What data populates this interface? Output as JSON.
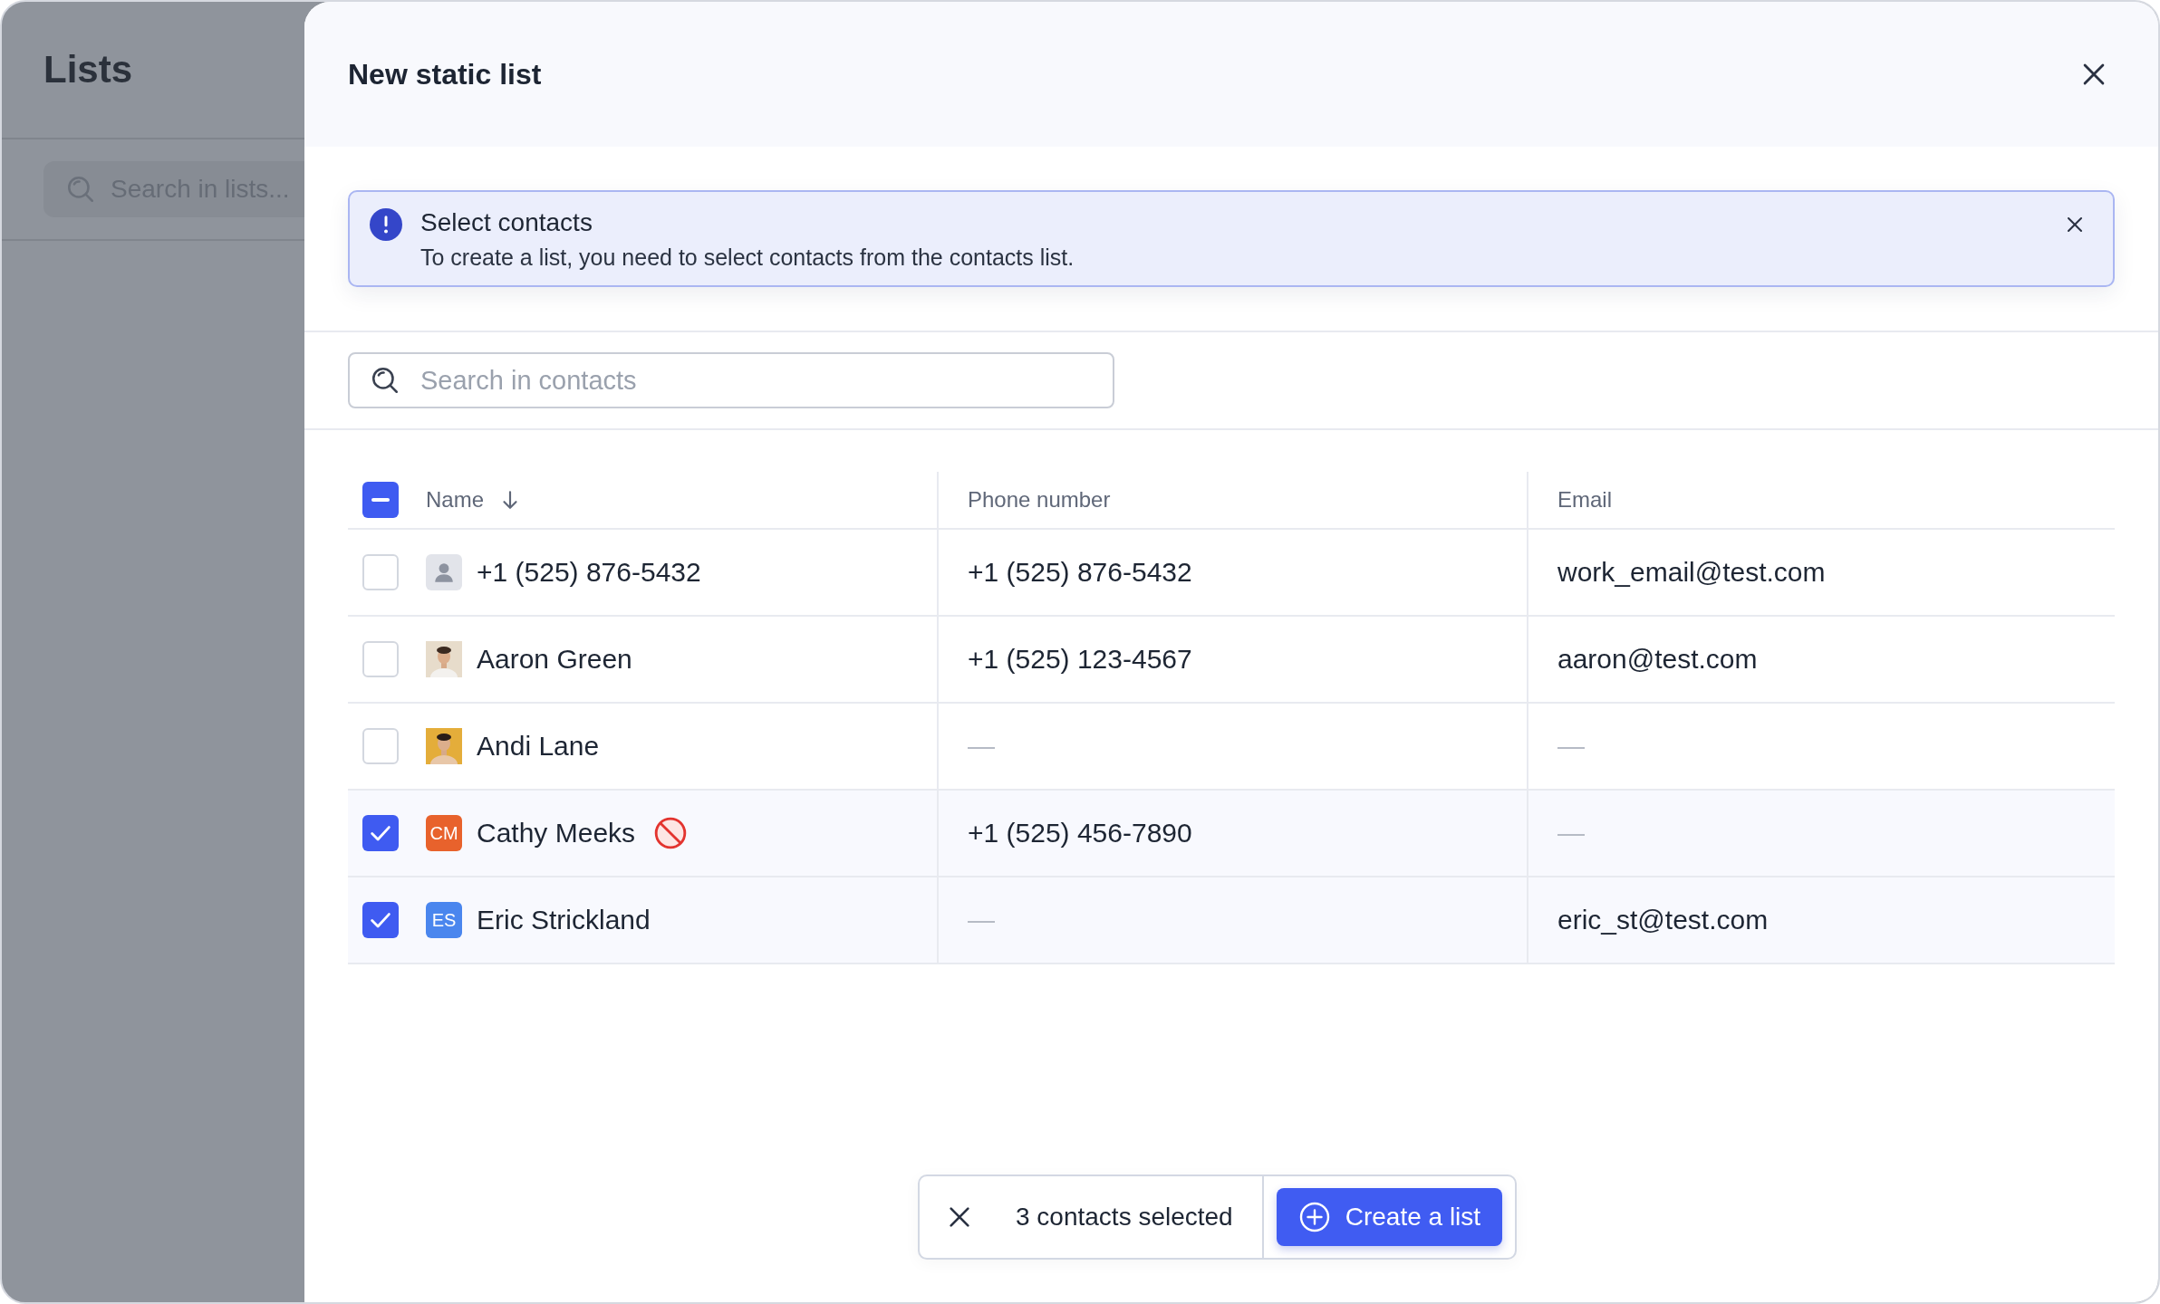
{
  "background": {
    "title": "Lists",
    "search": {
      "placeholder": "Search in lists..."
    }
  },
  "dialog": {
    "title": "New static list",
    "alert": {
      "title": "Select contacts",
      "message": "To create a list, you need to select contacts from the contacts list."
    },
    "search": {
      "placeholder": "Search in contacts"
    },
    "table": {
      "select_all": {
        "indeterminate": true
      },
      "columns": [
        {
          "label": "Name",
          "sorted": true
        },
        {
          "label": "Phone number",
          "sorted": false
        },
        {
          "label": "Email",
          "sorted": false
        }
      ],
      "rows": [
        {
          "selected": false,
          "avatar": {
            "kind": "placeholder"
          },
          "name": "+1 (525) 876-5432",
          "blocked": false,
          "phone": "+1 (525) 876-5432",
          "email": "work_email@test.com"
        },
        {
          "selected": false,
          "name": "Aaron Green",
          "blocked": false,
          "phone": "+1 (525) 123-4567",
          "email": "aaron@test.com"
        },
        {
          "selected": false,
          "name": "Andi Lane",
          "blocked": false,
          "phone": "—",
          "email": "—"
        },
        {
          "selected": true,
          "avatar": {
            "kind": "initials",
            "initials": "CM",
            "color": "#e8622c"
          },
          "name": "Cathy Meeks",
          "blocked": true,
          "phone": "+1 (525) 456-7890",
          "email": "—"
        },
        {
          "selected": true,
          "avatar": {
            "kind": "initials",
            "initials": "ES",
            "color": "#4a86ee"
          },
          "name": "Eric Strickland",
          "blocked": false,
          "phone": "—",
          "email": "eric_st@test.com"
        }
      ]
    },
    "selection_bar": {
      "count": "3 contacts selected",
      "action": "Create a list"
    }
  }
}
